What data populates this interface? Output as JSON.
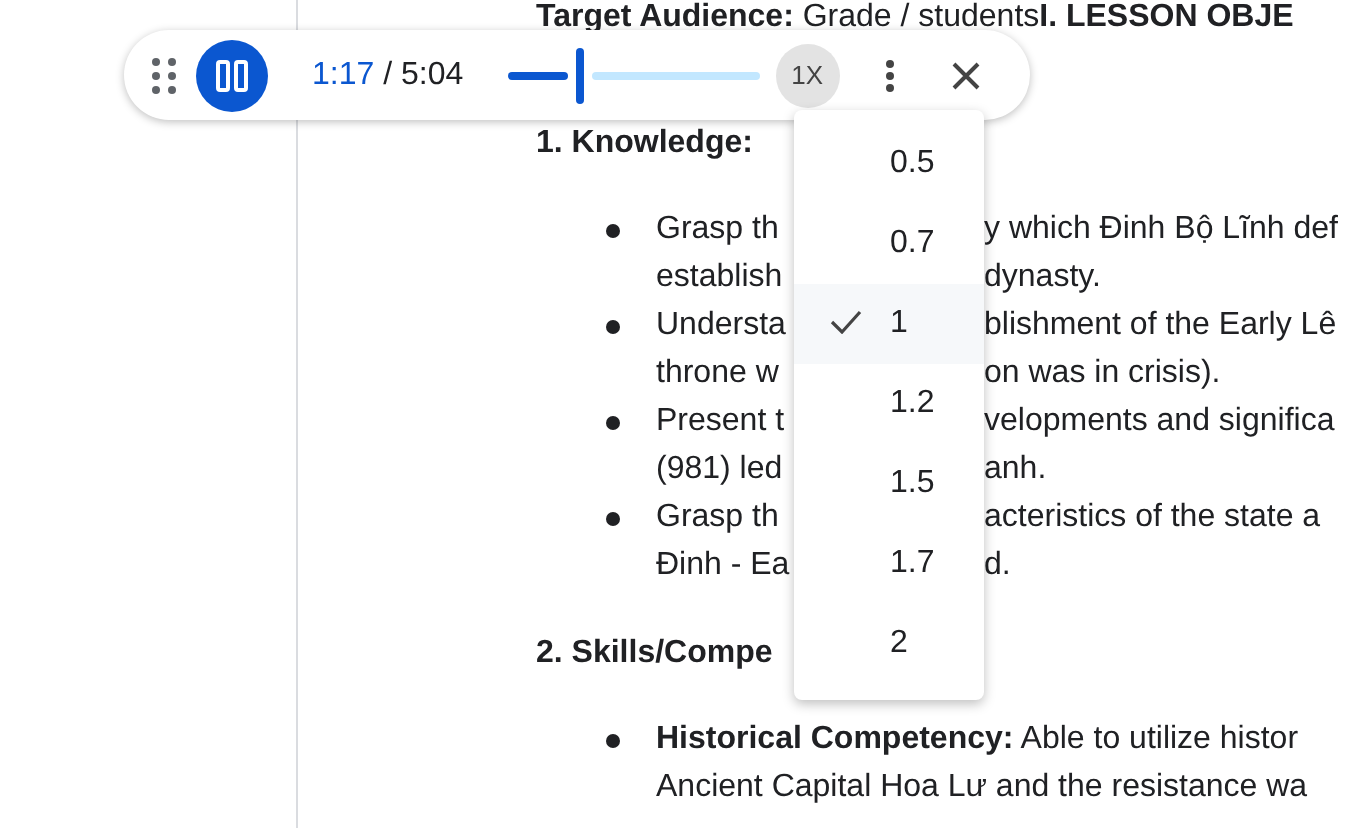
{
  "document": {
    "intro": "**Target Audience:** Grade / students**I. LESSON OBJE**",
    "sections": [
      {
        "heading": {
          "left": "1. Knowledge:"
        },
        "items": [
          {
            "lines": [
              {
                "left": "Grasp th",
                "right": "y which Đinh Bộ Lĩnh def"
              },
              {
                "left": "establish",
                "right": "dynasty."
              }
            ]
          },
          {
            "lines": [
              {
                "left": "Understa",
                "right": "blishment of the Early Lê"
              },
              {
                "left": "throne w",
                "right": "on was in crisis)."
              }
            ]
          },
          {
            "lines": [
              {
                "left": "Present t",
                "right": "velopments and significa"
              },
              {
                "left": "(981) led",
                "right": "anh."
              }
            ]
          },
          {
            "lines": [
              {
                "left": "Grasp th",
                "right": "acteristics of the state a"
              },
              {
                "left": "Đinh - Ea",
                "right": "d."
              }
            ]
          }
        ]
      },
      {
        "heading": {
          "left": "2. Skills/Compe"
        },
        "items": [
          {
            "lines": [
              {
                "left": "**Historical Competency:** Able to utilize histor"
              },
              {
                "left": "Ancient Capital Hoa Lư and the resistance wa"
              }
            ]
          }
        ]
      }
    ]
  },
  "player": {
    "playing": true,
    "elapsed": "1:17",
    "total": "/ 5:04",
    "level": 0.29,
    "speed": "1X"
  },
  "speed_menu": [
    {
      "label": "0.5",
      "selected": false
    },
    {
      "label": "0.7",
      "selected": false
    },
    {
      "label": "1",
      "selected": true
    },
    {
      "label": "1.2",
      "selected": false
    },
    {
      "label": "1.5",
      "selected": false
    },
    {
      "label": "1.7",
      "selected": false
    },
    {
      "label": "2",
      "selected": false
    }
  ]
}
